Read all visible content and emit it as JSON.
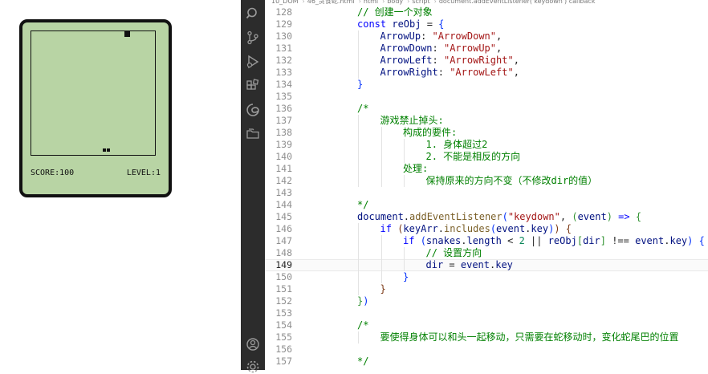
{
  "game": {
    "score_label": "SCORE:100",
    "level_label": "LEVEL:1"
  },
  "breadcrumb": [
    "10_DOM",
    "46_贪食蛇.html",
    "html",
    "body",
    "script",
    "document.addEventListener('keydown') callback"
  ],
  "activity_bar": [
    "search-icon",
    "source-control-icon",
    "run-debug-icon",
    "extensions-icon",
    "edge-devtools-icon",
    "folder-icon",
    "account-icon",
    "settings-icon"
  ],
  "editor": {
    "current_line": 149,
    "lines": [
      {
        "n": "128",
        "i": 2,
        "t": [
          [
            "cm",
            "// 创建一个对象"
          ]
        ]
      },
      {
        "n": "129",
        "i": 2,
        "t": [
          [
            "kw",
            "const "
          ],
          [
            "prop",
            "reObj"
          ],
          [
            "",
            " = "
          ],
          [
            "p1",
            "{"
          ]
        ]
      },
      {
        "n": "130",
        "i": 3,
        "t": [
          [
            "prop",
            "ArrowUp"
          ],
          [
            "",
            ": "
          ],
          [
            "str",
            "\"ArrowDown\""
          ],
          [
            "",
            ","
          ]
        ]
      },
      {
        "n": "131",
        "i": 3,
        "t": [
          [
            "prop",
            "ArrowDown"
          ],
          [
            "",
            ": "
          ],
          [
            "str",
            "\"ArrowUp\""
          ],
          [
            "",
            ","
          ]
        ]
      },
      {
        "n": "132",
        "i": 3,
        "t": [
          [
            "prop",
            "ArrowLeft"
          ],
          [
            "",
            ": "
          ],
          [
            "str",
            "\"ArrowRight\""
          ],
          [
            "",
            ","
          ]
        ]
      },
      {
        "n": "133",
        "i": 3,
        "t": [
          [
            "prop",
            "ArrowRight"
          ],
          [
            "",
            ": "
          ],
          [
            "str",
            "\"ArrowLeft\""
          ],
          [
            "",
            ","
          ]
        ]
      },
      {
        "n": "134",
        "i": 2,
        "t": [
          [
            "p1",
            "}"
          ]
        ]
      },
      {
        "n": "135",
        "i": 2,
        "t": []
      },
      {
        "n": "136",
        "i": 2,
        "t": [
          [
            "cm",
            "/*"
          ]
        ]
      },
      {
        "n": "137",
        "i": 3,
        "t": [
          [
            "cm",
            "游戏禁止掉头:"
          ]
        ]
      },
      {
        "n": "138",
        "i": 4,
        "t": [
          [
            "cm",
            "构成的要件:"
          ]
        ]
      },
      {
        "n": "139",
        "i": 5,
        "t": [
          [
            "cm",
            "1. 身体超过2"
          ]
        ]
      },
      {
        "n": "140",
        "i": 5,
        "t": [
          [
            "cm",
            "2. 不能是相反的方向"
          ]
        ]
      },
      {
        "n": "141",
        "i": 4,
        "t": [
          [
            "cm",
            "处理:"
          ]
        ]
      },
      {
        "n": "142",
        "i": 5,
        "t": [
          [
            "cm",
            "保持原来的方向不变（不修改dir的值）"
          ]
        ]
      },
      {
        "n": "143",
        "i": 2,
        "t": []
      },
      {
        "n": "144",
        "i": 2,
        "t": [
          [
            "cm",
            "*/"
          ]
        ]
      },
      {
        "n": "145",
        "i": 2,
        "t": [
          [
            "prop",
            "document"
          ],
          [
            "",
            "."
          ],
          [
            "fn",
            "addEventListener"
          ],
          [
            "p1",
            "("
          ],
          [
            "str",
            "\"keydown\""
          ],
          [
            "",
            ", "
          ],
          [
            "p2",
            "("
          ],
          [
            "prop",
            "event"
          ],
          [
            "p2",
            ")"
          ],
          [
            "",
            " "
          ],
          [
            "kw",
            "=>"
          ],
          [
            "",
            " "
          ],
          [
            "p2",
            "{"
          ]
        ]
      },
      {
        "n": "146",
        "i": 3,
        "t": [
          [
            "kw",
            "if "
          ],
          [
            "p3",
            "("
          ],
          [
            "prop",
            "keyArr"
          ],
          [
            "",
            "."
          ],
          [
            "fn",
            "includes"
          ],
          [
            "p1",
            "("
          ],
          [
            "prop",
            "event"
          ],
          [
            "",
            "."
          ],
          [
            "prop",
            "key"
          ],
          [
            "p1",
            ")"
          ],
          [
            "p3",
            ")"
          ],
          [
            "",
            " "
          ],
          [
            "p3",
            "{"
          ]
        ]
      },
      {
        "n": "147",
        "i": 4,
        "t": [
          [
            "kw",
            "if "
          ],
          [
            "p1",
            "("
          ],
          [
            "prop",
            "snakes"
          ],
          [
            "",
            "."
          ],
          [
            "prop",
            "length"
          ],
          [
            "",
            " < "
          ],
          [
            "num",
            "2"
          ],
          [
            "",
            " || "
          ],
          [
            "prop",
            "reObj"
          ],
          [
            "p2",
            "["
          ],
          [
            "prop",
            "dir"
          ],
          [
            "p2",
            "]"
          ],
          [
            "",
            " !== "
          ],
          [
            "prop",
            "event"
          ],
          [
            "",
            "."
          ],
          [
            "prop",
            "key"
          ],
          [
            "p1",
            ")"
          ],
          [
            "",
            " "
          ],
          [
            "p1",
            "{"
          ]
        ]
      },
      {
        "n": "148",
        "i": 5,
        "t": [
          [
            "cm",
            "// 设置方向"
          ]
        ]
      },
      {
        "n": "149",
        "i": 5,
        "t": [
          [
            "prop",
            "dir"
          ],
          [
            "",
            " = "
          ],
          [
            "prop",
            "event"
          ],
          [
            "",
            "."
          ],
          [
            "prop",
            "key"
          ]
        ]
      },
      {
        "n": "150",
        "i": 4,
        "t": [
          [
            "p1",
            "}"
          ]
        ]
      },
      {
        "n": "151",
        "i": 3,
        "t": [
          [
            "p3",
            "}"
          ]
        ]
      },
      {
        "n": "152",
        "i": 2,
        "t": [
          [
            "p2",
            "}"
          ],
          [
            "p1",
            ")"
          ]
        ]
      },
      {
        "n": "153",
        "i": 2,
        "t": []
      },
      {
        "n": "154",
        "i": 2,
        "t": [
          [
            "cm",
            "/*"
          ]
        ]
      },
      {
        "n": "155",
        "i": 3,
        "t": [
          [
            "cm",
            "要使得身体可以和头一起移动，只需要在蛇移动时，变化蛇尾巴的位置"
          ]
        ]
      },
      {
        "n": "156",
        "i": 2,
        "t": []
      },
      {
        "n": "157",
        "i": 2,
        "t": [
          [
            "cm",
            "*/"
          ]
        ]
      }
    ]
  }
}
